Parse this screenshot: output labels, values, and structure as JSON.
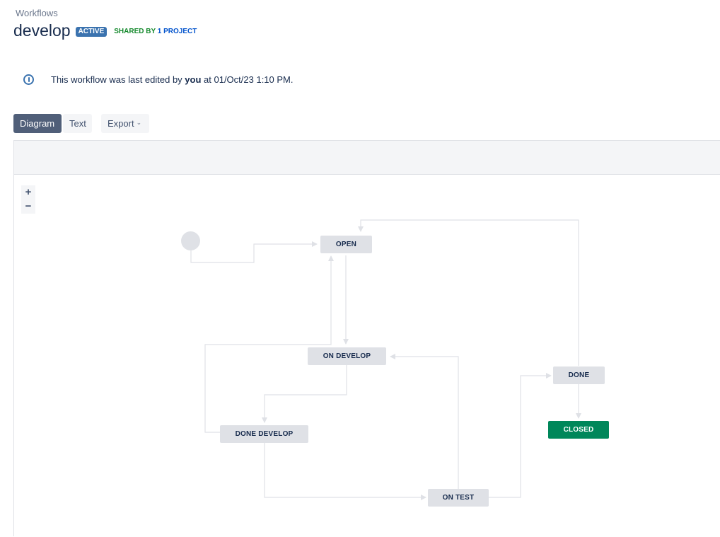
{
  "breadcrumb": "Workflows",
  "workflow": {
    "name": "develop",
    "status_badge": "ACTIVE",
    "shared_prefix": "SHARED BY ",
    "shared_link": "1 PROJECT"
  },
  "info": {
    "prefix": "This workflow was last edited by ",
    "user": "you",
    "suffix": " at 01/Oct/23 1:10 PM."
  },
  "view_tabs": {
    "diagram": "Diagram",
    "text": "Text",
    "export": "Export"
  },
  "zoom": {
    "in": "+",
    "out": "−"
  },
  "statuses": {
    "open": "OPEN",
    "on_develop": "ON DEVELOP",
    "done_develop": "DONE DEVELOP",
    "on_test": "ON TEST",
    "done": "DONE",
    "closed": "CLOSED"
  },
  "colors": {
    "active_badge": "#3b73af",
    "shared_green": "#14892c",
    "shared_blue": "#0052cc",
    "node_gray": "#dfe1e6",
    "closed_green": "#00875a",
    "selected_tab": "#505f79"
  },
  "icons": {
    "info": "info-circle-icon",
    "export_chevron": "chevron-down-icon"
  }
}
